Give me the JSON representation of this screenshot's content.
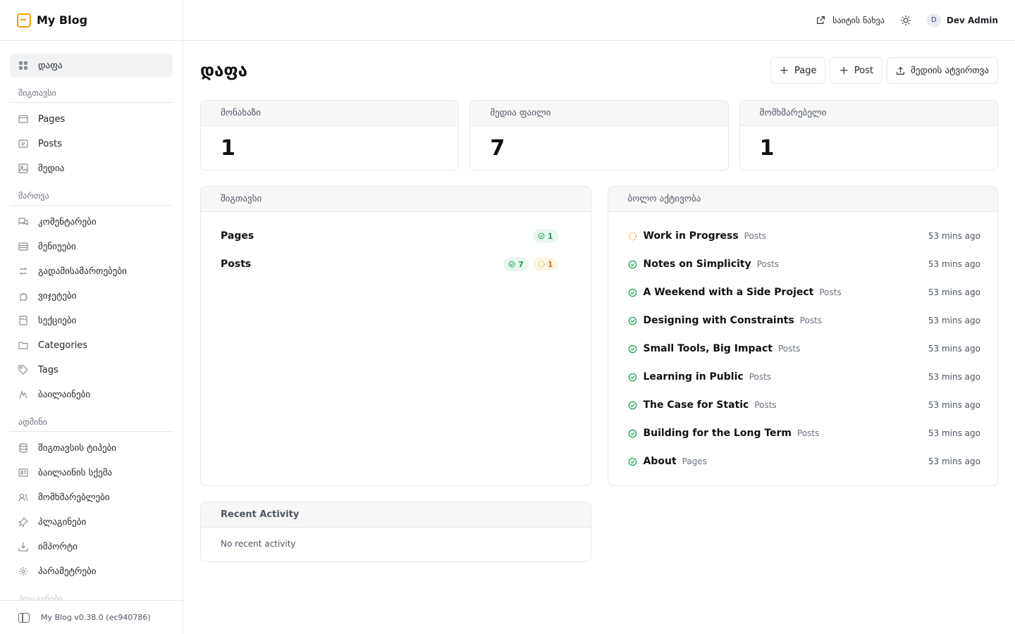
{
  "brand": {
    "name": "My Blog"
  },
  "sidebar": {
    "items": [
      {
        "label": "დაფა",
        "icon": "dashboard-icon",
        "active": true
      },
      {
        "group": "შიგთავსი"
      },
      {
        "label": "Pages",
        "icon": "page-icon"
      },
      {
        "label": "Posts",
        "icon": "post-icon"
      },
      {
        "label": "მედია",
        "icon": "media-icon"
      },
      {
        "group": "მართვა"
      },
      {
        "label": "კომენტარები",
        "icon": "comments-icon"
      },
      {
        "label": "მენიუები",
        "icon": "menu-icon"
      },
      {
        "label": "გადამისამართებები",
        "icon": "redirect-icon"
      },
      {
        "label": "ვიჯეტები",
        "icon": "widget-icon"
      },
      {
        "label": "სექციები",
        "icon": "sections-icon"
      },
      {
        "label": "Categories",
        "icon": "folder-icon"
      },
      {
        "label": "Tags",
        "icon": "tag-icon"
      },
      {
        "label": "ბაილაინები",
        "icon": "byline-icon"
      },
      {
        "group": "ადმინი"
      },
      {
        "label": "შიგთავსის ტიპები",
        "icon": "database-icon"
      },
      {
        "label": "ბაილაინის სქემა",
        "icon": "schema-icon"
      },
      {
        "label": "მომხმარებლები",
        "icon": "users-icon"
      },
      {
        "label": "პლაგინები",
        "icon": "plugin-icon"
      },
      {
        "label": "იმპორტი",
        "icon": "import-icon"
      },
      {
        "label": "პარამეტრები",
        "icon": "gear-icon"
      },
      {
        "group": "პლაგინები"
      }
    ],
    "footer": "My Blog v0.38.0 (ec940786)"
  },
  "topbar": {
    "view_site": "საიტის ნახვა",
    "user_initial": "D",
    "user_name": "Dev Admin"
  },
  "page": {
    "title": "დაფა",
    "actions": {
      "new_page": "Page",
      "new_post": "Post",
      "upload_media": "მედიის ატვირთვა"
    }
  },
  "stats": [
    {
      "label": "მონახაზი",
      "value": "1"
    },
    {
      "label": "მედია ფაილი",
      "value": "7"
    },
    {
      "label": "მომხმარებელი",
      "value": "1"
    }
  ],
  "content": {
    "title": "შიგთავსი",
    "rows": [
      {
        "label": "Pages",
        "published": "1",
        "drafts": null
      },
      {
        "label": "Posts",
        "published": "7",
        "drafts": "1"
      }
    ]
  },
  "activity": {
    "title": "ბოლო აქტივობა",
    "items": [
      {
        "title": "Work in Progress",
        "type": "Posts",
        "time": "53 mins ago",
        "status": "draft"
      },
      {
        "title": "Notes on Simplicity",
        "type": "Posts",
        "time": "53 mins ago",
        "status": "published"
      },
      {
        "title": "A Weekend with a Side Project",
        "type": "Posts",
        "time": "53 mins ago",
        "status": "published"
      },
      {
        "title": "Designing with Constraints",
        "type": "Posts",
        "time": "53 mins ago",
        "status": "published"
      },
      {
        "title": "Small Tools, Big Impact",
        "type": "Posts",
        "time": "53 mins ago",
        "status": "published"
      },
      {
        "title": "Learning in Public",
        "type": "Posts",
        "time": "53 mins ago",
        "status": "published"
      },
      {
        "title": "The Case for Static",
        "type": "Posts",
        "time": "53 mins ago",
        "status": "published"
      },
      {
        "title": "Building for the Long Term",
        "type": "Posts",
        "time": "53 mins ago",
        "status": "published"
      },
      {
        "title": "About",
        "type": "Pages",
        "time": "53 mins ago",
        "status": "published"
      }
    ]
  },
  "recent": {
    "title": "Recent Activity",
    "empty": "No recent activity"
  },
  "colors": {
    "published": "#22a35a",
    "draft": "#f0a020",
    "accent": "#f59e0b"
  }
}
